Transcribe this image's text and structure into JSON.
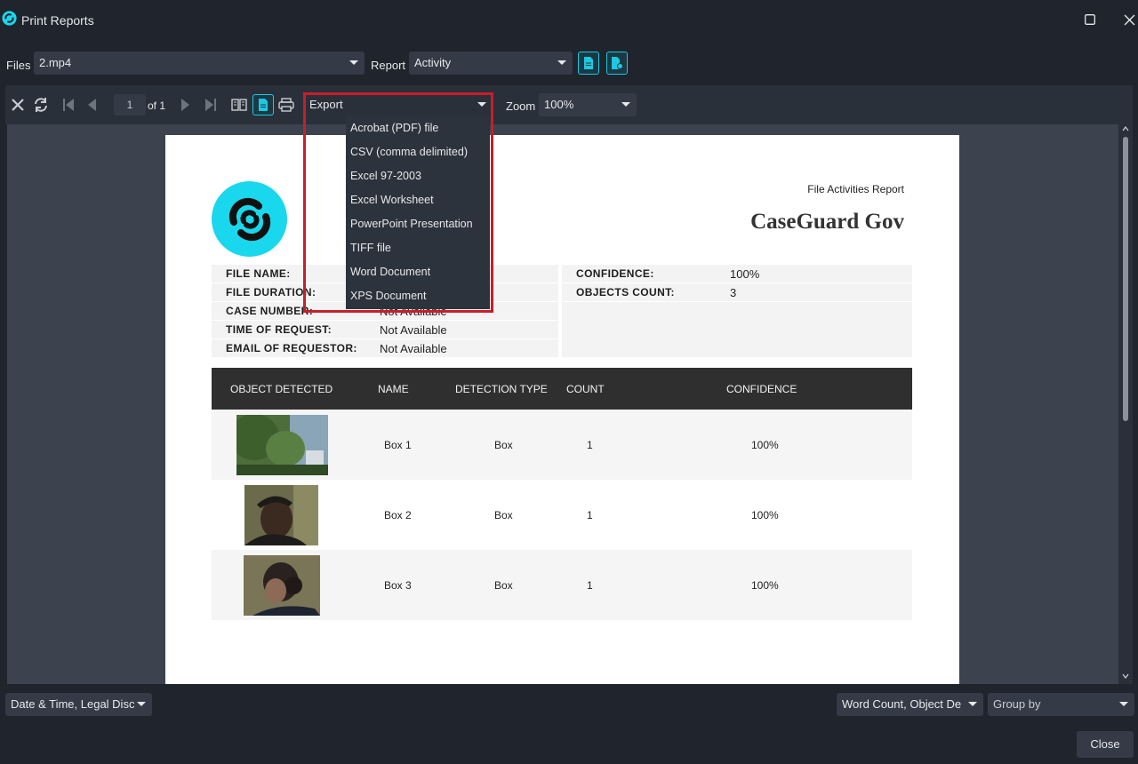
{
  "window": {
    "title": "Print Reports"
  },
  "filesbar": {
    "files_label": "Files",
    "files_value": "2.mp4",
    "report_label": "Report",
    "report_value": "Activity"
  },
  "toolbar": {
    "page_current": "1",
    "page_of": "of 1",
    "export_label": "Export",
    "zoom_label": "Zoom",
    "zoom_value": "100%"
  },
  "export_menu": [
    "Acrobat (PDF) file",
    "CSV (comma delimited)",
    "Excel 97-2003",
    "Excel Worksheet",
    "PowerPoint Presentation",
    "TIFF file",
    "Word Document",
    "XPS Document"
  ],
  "report": {
    "report_title": "File Activities Report",
    "org_name": "CaseGuard Gov",
    "info_left": [
      {
        "key": "FILE NAME:",
        "value": ""
      },
      {
        "key": "FILE DURATION:",
        "value": ""
      },
      {
        "key": "CASE NUMBER:",
        "value": "Not Available"
      },
      {
        "key": "TIME OF REQUEST:",
        "value": "Not Available"
      },
      {
        "key": "EMAIL OF REQUESTOR:",
        "value": "Not Available"
      }
    ],
    "info_right": [
      {
        "key": "CONFIDENCE:",
        "value": "100%"
      },
      {
        "key": "OBJECTS COUNT:",
        "value": "3"
      }
    ],
    "table": {
      "headers": [
        "OBJECT DETECTED",
        "NAME",
        "DETECTION TYPE",
        "COUNT",
        "CONFIDENCE"
      ],
      "rows": [
        {
          "name": "Box 1",
          "type": "Box",
          "count": "1",
          "confidence": "100%"
        },
        {
          "name": "Box 2",
          "type": "Box",
          "count": "1",
          "confidence": "100%"
        },
        {
          "name": "Box 3",
          "type": "Box",
          "count": "1",
          "confidence": "100%"
        }
      ]
    }
  },
  "bottombar": {
    "left_select": "Date & Time, Legal Disc",
    "right_select": "Word Count, Object De",
    "group_by": "Group by",
    "close_label": "Close"
  },
  "colors": {
    "accent": "#19d7ec",
    "highlight": "#c81e2a",
    "background": "#1f242d"
  }
}
